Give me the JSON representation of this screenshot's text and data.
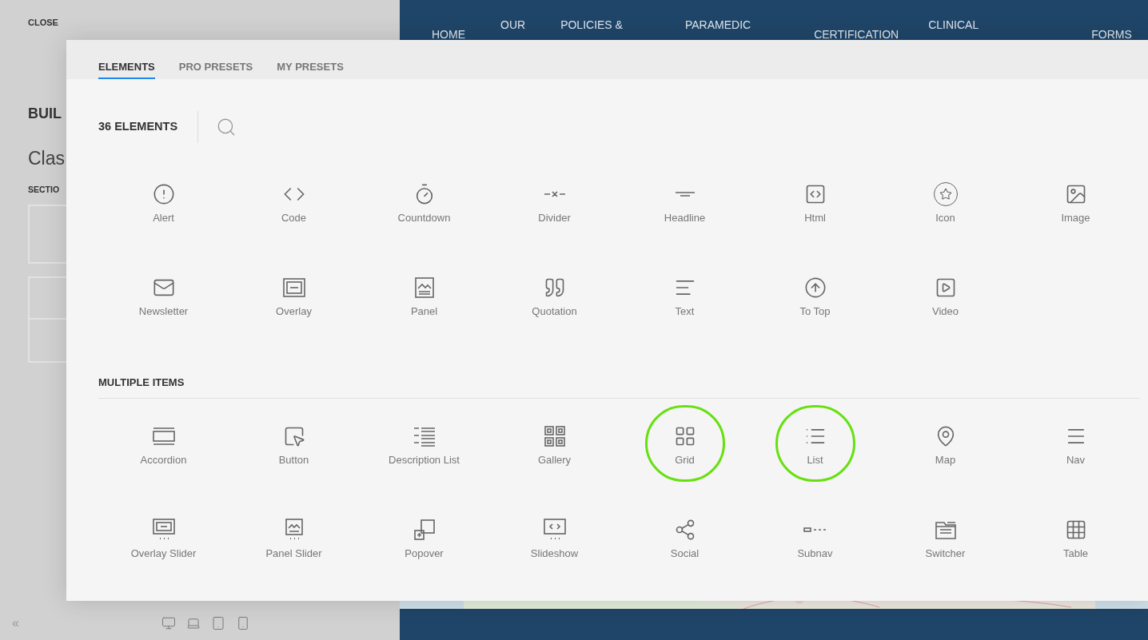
{
  "sidebar": {
    "close": "CLOSE",
    "heading": "BUIL",
    "title": "Clas",
    "section_label": "SECTIO",
    "collapse": "«"
  },
  "site_nav": [
    "HOME",
    "OUR",
    "POLICIES &",
    "PARAMEDIC",
    "CERTIFICATION",
    "CLINICAL",
    "FORMS"
  ],
  "modal": {
    "tabs": [
      {
        "label": "ELEMENTS",
        "selected": true
      },
      {
        "label": "PRO PRESETS",
        "selected": false
      },
      {
        "label": "MY PRESETS",
        "selected": false
      }
    ],
    "count": "36 ELEMENTS",
    "sections": [
      {
        "items": [
          {
            "label": "Alert",
            "highlighted": false
          },
          {
            "label": "Code",
            "highlighted": false
          },
          {
            "label": "Countdown",
            "highlighted": false
          },
          {
            "label": "Divider",
            "highlighted": false
          },
          {
            "label": "Headline",
            "highlighted": false
          },
          {
            "label": "Html",
            "highlighted": false
          },
          {
            "label": "Icon",
            "highlighted": false
          },
          {
            "label": "Image",
            "highlighted": false
          },
          {
            "label": "Newsletter",
            "highlighted": false
          },
          {
            "label": "Overlay",
            "highlighted": false
          },
          {
            "label": "Panel",
            "highlighted": false
          },
          {
            "label": "Quotation",
            "highlighted": false
          },
          {
            "label": "Text",
            "highlighted": false
          },
          {
            "label": "To Top",
            "highlighted": false
          },
          {
            "label": "Video",
            "highlighted": false
          }
        ]
      },
      {
        "title": "MULTIPLE ITEMS",
        "items": [
          {
            "label": "Accordion",
            "highlighted": false
          },
          {
            "label": "Button",
            "highlighted": false
          },
          {
            "label": "Description List",
            "highlighted": false
          },
          {
            "label": "Gallery",
            "highlighted": false
          },
          {
            "label": "Grid",
            "highlighted": true
          },
          {
            "label": "List",
            "highlighted": true
          },
          {
            "label": "Map",
            "highlighted": false
          },
          {
            "label": "Nav",
            "highlighted": false
          },
          {
            "label": "Overlay Slider",
            "highlighted": false
          },
          {
            "label": "Panel Slider",
            "highlighted": false
          },
          {
            "label": "Popover",
            "highlighted": false
          },
          {
            "label": "Slideshow",
            "highlighted": false
          },
          {
            "label": "Social",
            "highlighted": false
          },
          {
            "label": "Subnav",
            "highlighted": false
          },
          {
            "label": "Switcher",
            "highlighted": false
          },
          {
            "label": "Table",
            "highlighted": false
          }
        ]
      }
    ]
  }
}
